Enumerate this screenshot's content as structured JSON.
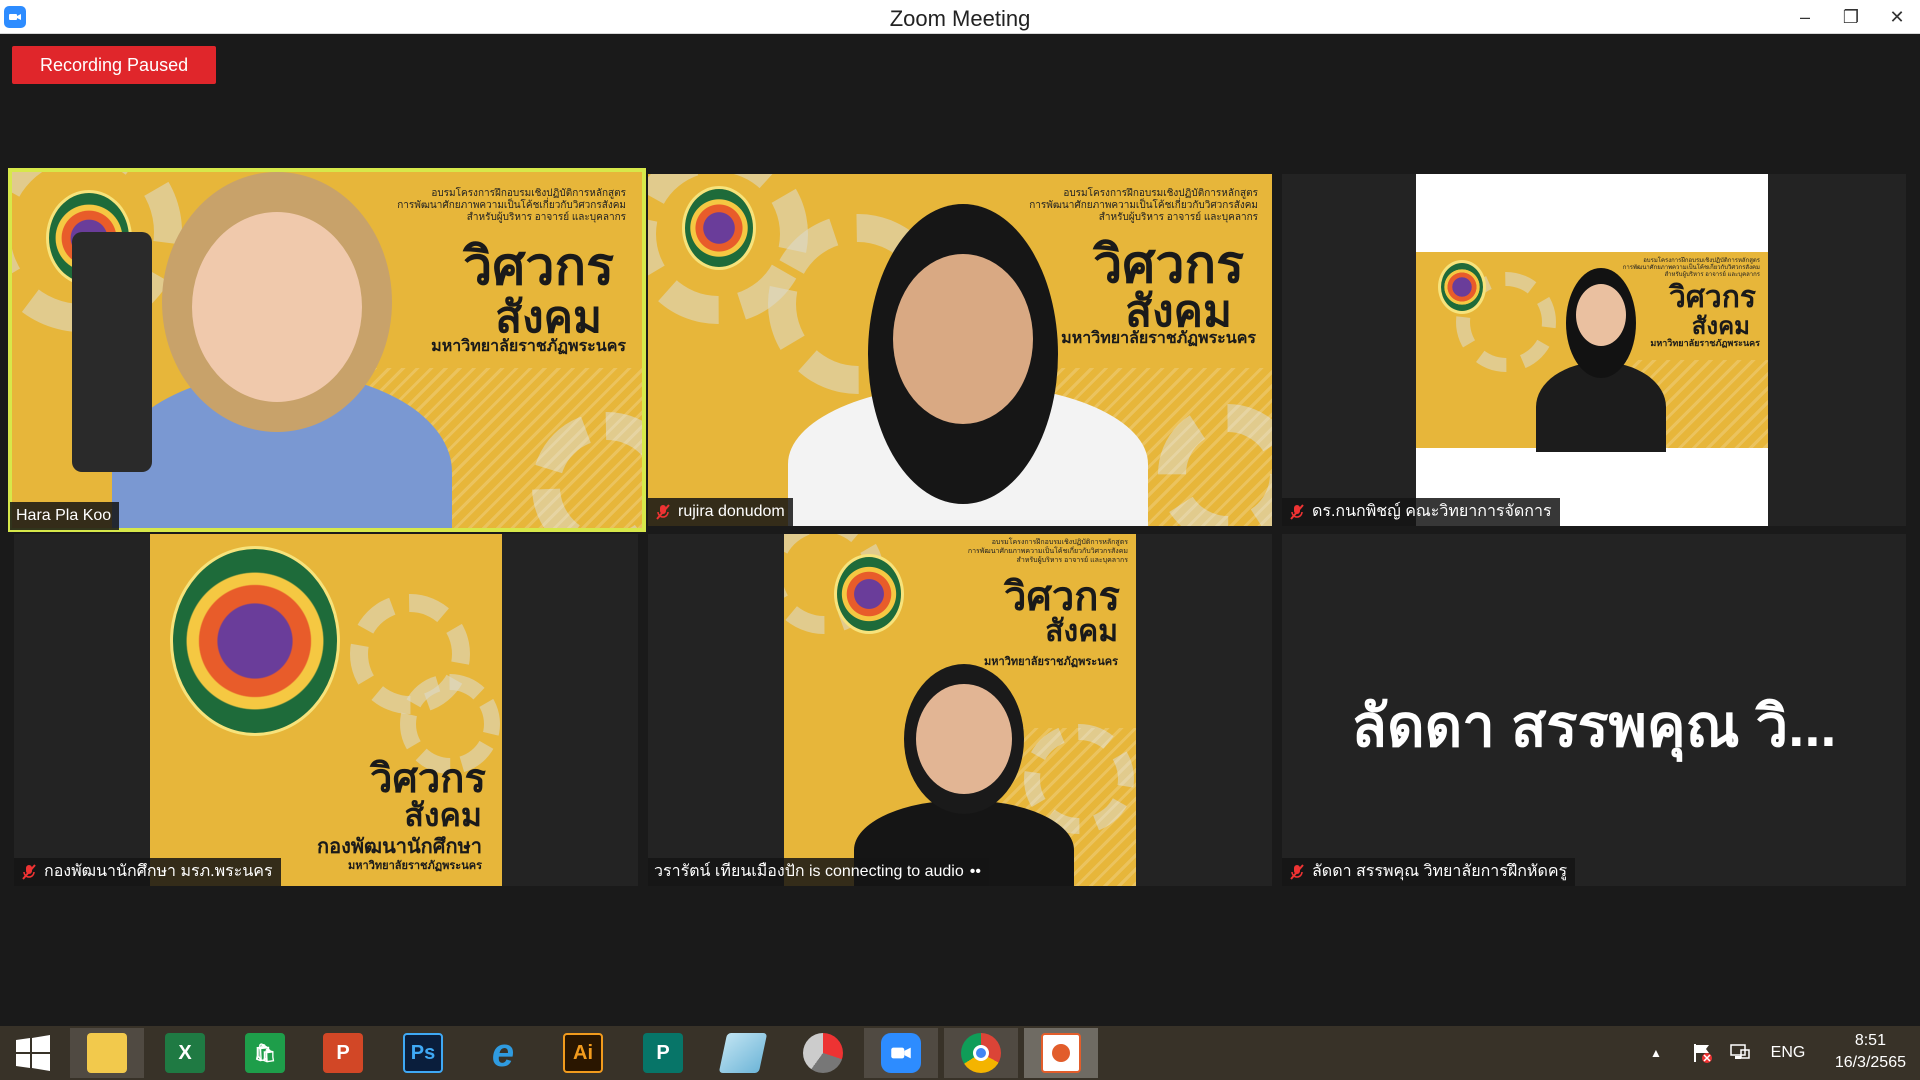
{
  "window": {
    "title": "Zoom Meeting",
    "minimize": "–",
    "maximize": "❐",
    "close": "✕"
  },
  "recording": {
    "label": "Recording Paused",
    "color": "#e0262b"
  },
  "branding": {
    "project_line1": "อบรมโครงการฝึกอบรมเชิงปฏิบัติการหลักสูตร",
    "project_line2": "การพัฒนาศักยภาพความเป็นโค้ชเกี่ยวกับวิศวกรสังคม",
    "project_line3": "สำหรับผู้บริหาร อาจารย์ และบุคลากร",
    "big_title_1": "วิศวกร",
    "big_title_2": "สังคม",
    "university": "มหาวิทยาลัยราชภัฏพระนคร",
    "student_dev": "กองพัฒนานักศึกษา",
    "accent_color": "#e7b63a"
  },
  "participants": [
    {
      "name": "Hara Pla Koo",
      "muted": false,
      "active_speaker": true
    },
    {
      "name": "rujira donudom",
      "muted": true,
      "active_speaker": false
    },
    {
      "name": "ดร.กนกพิชญ์ คณะวิทยาการจัดการ",
      "muted": true,
      "active_speaker": false
    },
    {
      "name": "กองพัฒนานักศึกษา มรภ.พระนคร",
      "muted": true,
      "active_speaker": false
    },
    {
      "name": "วรารัตน์ เทียนเมืองปัก is connecting to audio",
      "muted": false,
      "active_speaker": false
    },
    {
      "name": "ลัดดา สรรพคุณ วิทยาลัยการฝึกหัดครู",
      "muted": true,
      "active_speaker": false,
      "display_text": "ลัดดา สรรพคุณ วิ..."
    }
  ],
  "taskbar": {
    "apps": [
      {
        "name": "file-explorer",
        "label": ""
      },
      {
        "name": "excel",
        "label": "X"
      },
      {
        "name": "store",
        "label": "🛍"
      },
      {
        "name": "powerpoint",
        "label": "P"
      },
      {
        "name": "photoshop",
        "label": "Ps"
      },
      {
        "name": "internet-explorer",
        "label": "e"
      },
      {
        "name": "illustrator",
        "label": "Ai"
      },
      {
        "name": "publisher",
        "label": "P"
      },
      {
        "name": "notepad",
        "label": ""
      },
      {
        "name": "photoscape",
        "label": ""
      },
      {
        "name": "zoom",
        "label": ""
      },
      {
        "name": "chrome",
        "label": ""
      },
      {
        "name": "photos",
        "label": ""
      }
    ],
    "language": "ENG",
    "time": "8:51",
    "date": "16/3/2565"
  }
}
